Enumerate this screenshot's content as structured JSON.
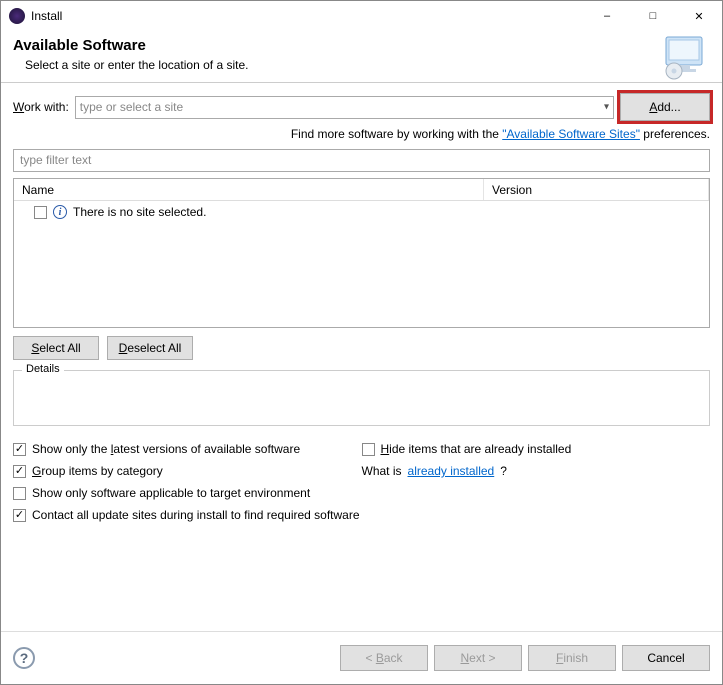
{
  "window": {
    "title": "Install"
  },
  "header": {
    "title": "Available Software",
    "subtitle": "Select a site or enter the location of a site."
  },
  "workwith": {
    "label": "Work with:",
    "placeholder": "type or select a site",
    "add_label": "Add..."
  },
  "hint": {
    "prefix": "Find more software by working with the ",
    "link": "\"Available Software Sites\"",
    "suffix": " preferences."
  },
  "filter": {
    "placeholder": "type filter text"
  },
  "table": {
    "columns": {
      "name": "Name",
      "version": "Version"
    },
    "empty_row": "There is no site selected."
  },
  "selection": {
    "select_all": "Select All",
    "deselect_all": "Deselect All"
  },
  "details": {
    "legend": "Details"
  },
  "options": {
    "show_latest": "Show only the latest versions of available software",
    "group_category": "Group items by category",
    "applicable_env": "Show only software applicable to target environment",
    "contact_sites": "Contact all update sites during install to find required software",
    "hide_installed": "Hide items that are already installed",
    "what_is_prefix": "What is ",
    "what_is_link": "already installed",
    "what_is_suffix": "?"
  },
  "footer": {
    "back": "< Back",
    "next": "Next >",
    "finish": "Finish",
    "cancel": "Cancel"
  }
}
